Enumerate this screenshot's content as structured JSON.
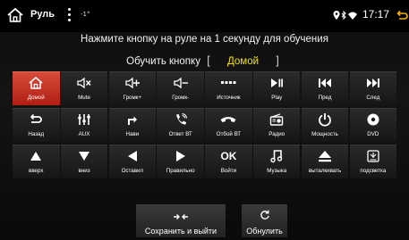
{
  "status_bar": {
    "title": "Руль",
    "temperature": "-1°",
    "time": "17:17"
  },
  "instruction": "Нажмите кнопку на руле на 1 секунду для обучения",
  "learn": {
    "label": "Обучить кнопку",
    "bracket_open": "[",
    "value": "Домой",
    "bracket_close": "]"
  },
  "keys": [
    {
      "label": "Домой",
      "icon": "home-icon",
      "active": true
    },
    {
      "label": "Mute",
      "icon": "mute-icon"
    },
    {
      "label": "Громк+",
      "icon": "volume-up-icon"
    },
    {
      "label": "Громк-",
      "icon": "volume-down-icon"
    },
    {
      "label": "Источник",
      "icon": "source-icon"
    },
    {
      "label": "Play",
      "icon": "play-pause-icon"
    },
    {
      "label": "Пред",
      "icon": "previous-icon"
    },
    {
      "label": "След",
      "icon": "next-icon"
    },
    {
      "label": "Назад",
      "icon": "back-icon"
    },
    {
      "label": "AUX",
      "icon": "aux-icon"
    },
    {
      "label": "Нави",
      "icon": "navi-icon"
    },
    {
      "label": "Ответ ВТ",
      "icon": "answer-call-icon"
    },
    {
      "label": "Отбой ВТ",
      "icon": "hangup-icon"
    },
    {
      "label": "Радио",
      "icon": "radio-icon"
    },
    {
      "label": "Мощность",
      "icon": "power-icon"
    },
    {
      "label": "DVD",
      "icon": "dvd-icon"
    },
    {
      "label": "вверх",
      "icon": "arrow-up-icon"
    },
    {
      "label": "вниз",
      "icon": "arrow-down-icon"
    },
    {
      "label": "Оставил",
      "icon": "arrow-left-icon"
    },
    {
      "label": "Правильно",
      "icon": "arrow-right-icon"
    },
    {
      "label": "Войти",
      "icon": "ok-icon",
      "glyph": "OK"
    },
    {
      "label": "Музыка",
      "icon": "music-icon"
    },
    {
      "label": "выталкивать",
      "icon": "eject-icon"
    },
    {
      "label": "подсветка",
      "icon": "backlight-icon"
    }
  ],
  "buttons": {
    "save": "Сохранить и выйти",
    "reset": "Обнулить"
  },
  "colors": {
    "active_key": "#c8291c",
    "selected_value": "#f0e000"
  }
}
